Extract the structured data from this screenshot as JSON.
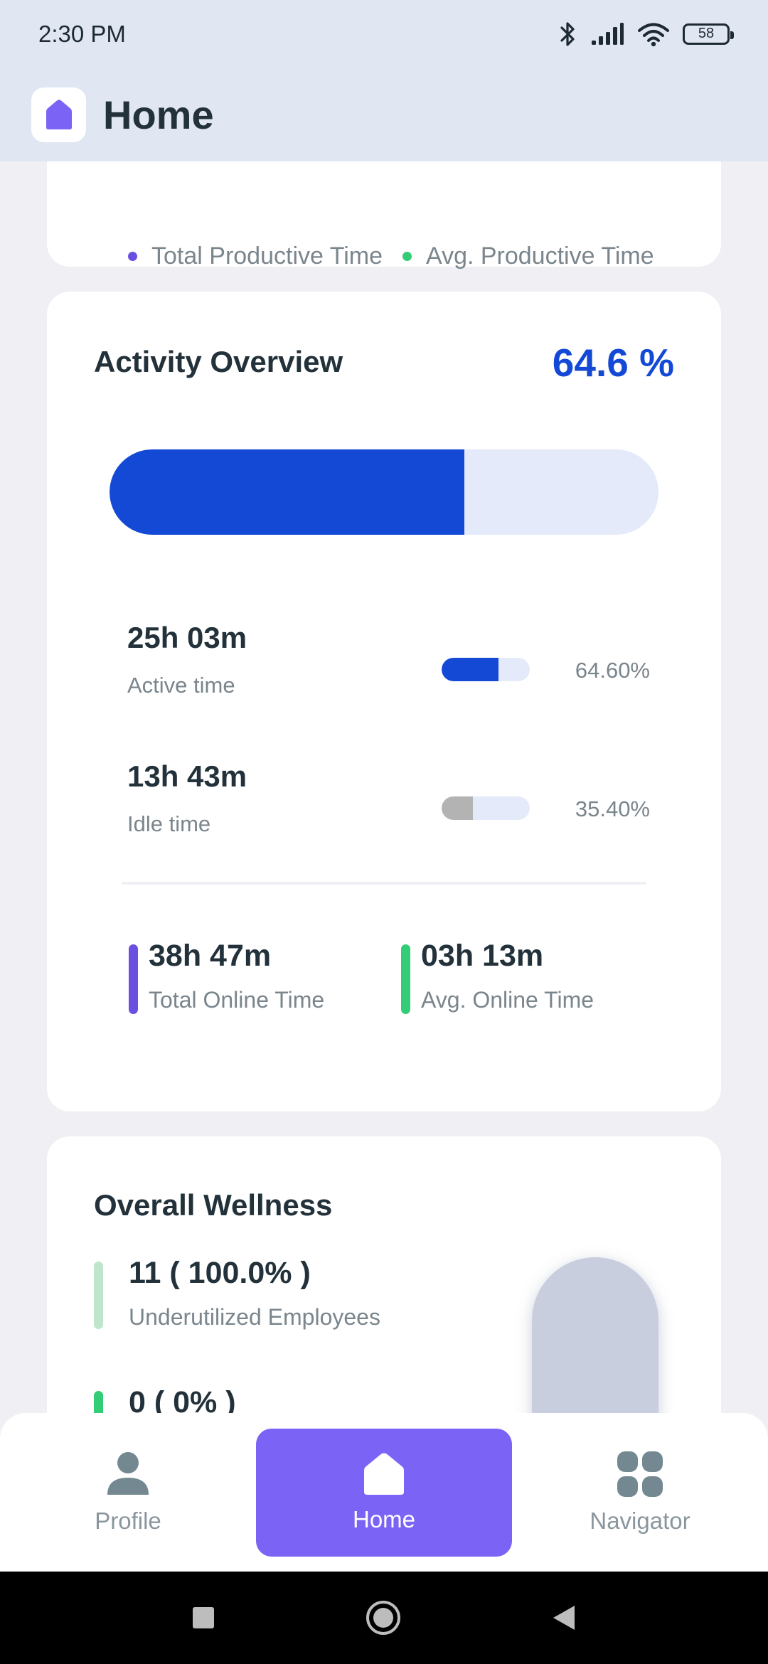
{
  "status_bar": {
    "time": "2:30 PM",
    "battery": "58"
  },
  "app_bar": {
    "title": "Home"
  },
  "top_card": {
    "legend": [
      {
        "label": "Total Productive Time",
        "color": "#6a4fe0"
      },
      {
        "label": "Avg. Productive Time",
        "color": "#33cc77"
      }
    ]
  },
  "activity_overview": {
    "title": "Activity Overview",
    "percent": "64.6 %",
    "progress_fraction": 0.646,
    "accent": "#1449d6",
    "metrics": [
      {
        "value": "25h 03m",
        "label": "Active time",
        "percent": "64.60%",
        "fraction": 0.646,
        "color": "#1449d6"
      },
      {
        "value": "13h 43m",
        "label": "Idle time",
        "percent": "35.40%",
        "fraction": 0.354,
        "color": "#b3b3b3"
      }
    ],
    "online": [
      {
        "value": "38h 47m",
        "label": "Total Online Time",
        "color": "#6a4fe0"
      },
      {
        "value": "03h 13m",
        "label": "Avg. Online Time",
        "color": "#33cc77"
      }
    ]
  },
  "wellness": {
    "title": "Overall Wellness",
    "items": [
      {
        "value": "11 ( 100.0% )",
        "label": "Underutilized Employees",
        "color": "#bfe6cc"
      },
      {
        "value": "0 ( 0% )",
        "label": "",
        "color": "#33cc77"
      }
    ]
  },
  "bottom_nav": {
    "items": [
      {
        "label": "Profile",
        "icon": "person-icon",
        "active": false
      },
      {
        "label": "Home",
        "icon": "home-icon",
        "active": true
      },
      {
        "label": "Navigator",
        "icon": "grid-icon",
        "active": false
      }
    ]
  },
  "system_nav": {
    "icons": [
      "recent-apps-icon",
      "home-circle-icon",
      "back-icon"
    ]
  }
}
